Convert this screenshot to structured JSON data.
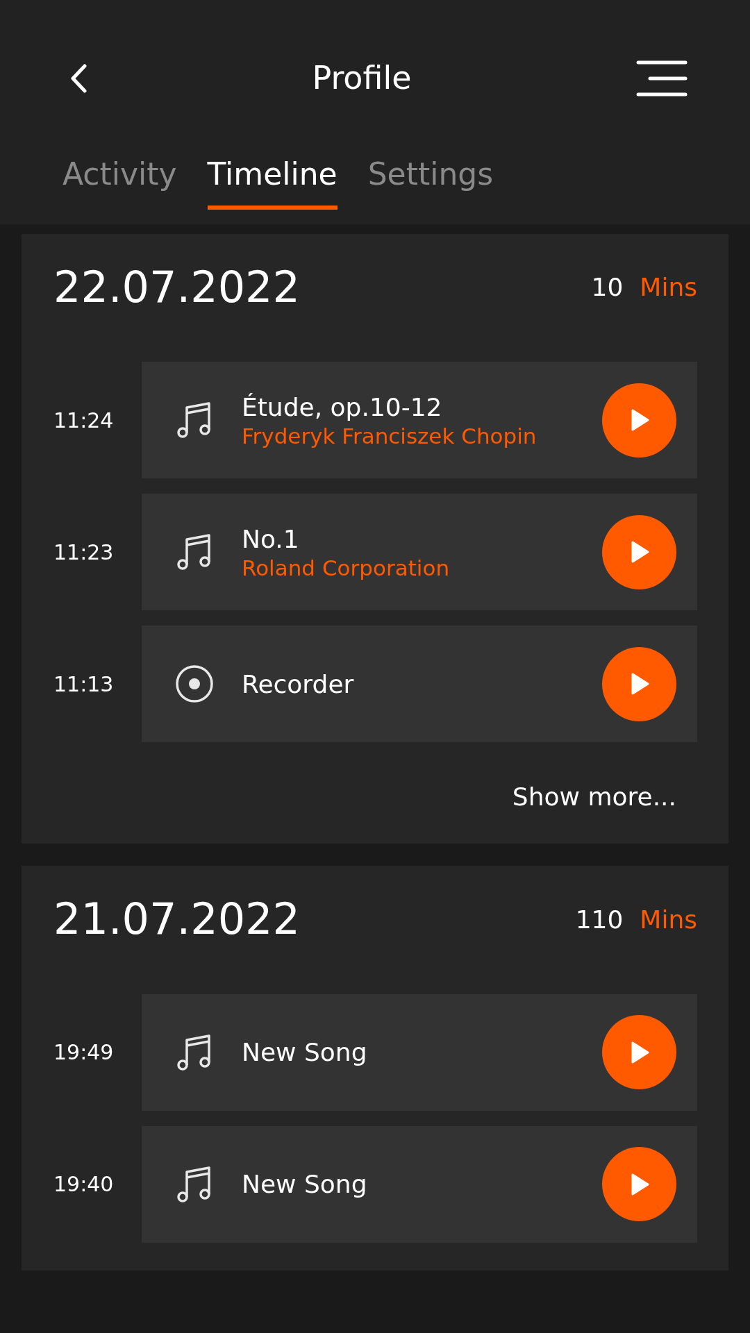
{
  "header": {
    "title": "Profile"
  },
  "tabs": [
    {
      "label": "Activity",
      "selected": false
    },
    {
      "label": "Timeline",
      "selected": true
    },
    {
      "label": "Settings",
      "selected": false
    }
  ],
  "days": [
    {
      "date": "22.07.2022",
      "minutes": "10",
      "unit": "Mins",
      "show_more": "Show more...",
      "entries": [
        {
          "time": "11:24",
          "kind": "song",
          "title": "Étude, op.10-12",
          "artist": "Fryderyk Franciszek Chopin"
        },
        {
          "time": "11:23",
          "kind": "song",
          "title": "No.1",
          "artist": "Roland Corporation"
        },
        {
          "time": "11:13",
          "kind": "recorder",
          "title": "Recorder"
        }
      ]
    },
    {
      "date": "21.07.2022",
      "minutes": "110",
      "unit": "Mins",
      "entries": [
        {
          "time": "19:49",
          "kind": "song",
          "title": "New Song"
        },
        {
          "time": "19:40",
          "kind": "song",
          "title": "New Song"
        }
      ]
    }
  ]
}
